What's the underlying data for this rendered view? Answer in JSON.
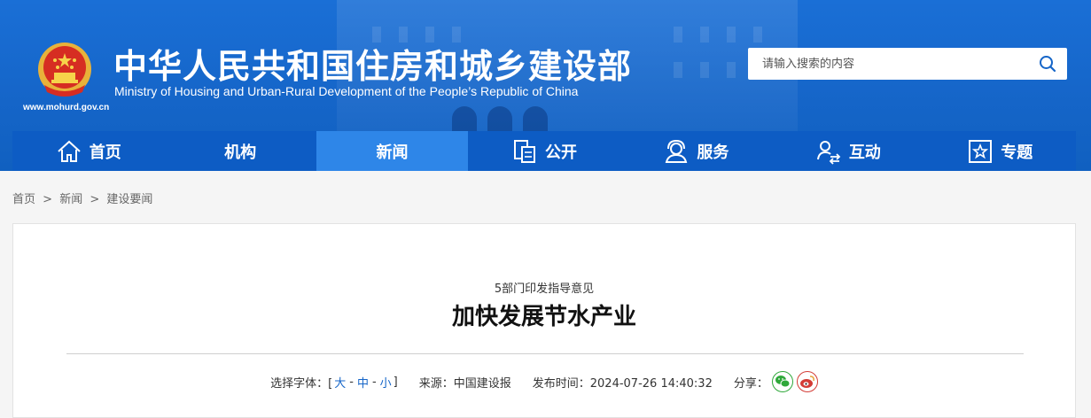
{
  "header": {
    "title": "中华人民共和国住房和城乡建设部",
    "subtitle": "Ministry of Housing and Urban-Rural Development of the People’s Republic of China",
    "url": "www.mohurd.gov.cn"
  },
  "search": {
    "placeholder": "请输入搜索的内容"
  },
  "nav": {
    "items": [
      {
        "label": "首页",
        "icon": "home-icon"
      },
      {
        "label": "机构"
      },
      {
        "label": "新闻"
      },
      {
        "label": "公开",
        "icon": "document-icon"
      },
      {
        "label": "服务",
        "icon": "service-icon"
      },
      {
        "label": "互动",
        "icon": "interact-icon"
      },
      {
        "label": "专题",
        "icon": "star-icon"
      }
    ],
    "active": "新闻"
  },
  "breadcrumb": {
    "items": [
      "首页",
      "新闻",
      "建设要闻"
    ],
    "sep": ">"
  },
  "article": {
    "kicker": "5部门印发指导意见",
    "title": "加快发展节水产业",
    "font_label": "选择字体：[",
    "font_large": "大",
    "font_medium": "中",
    "font_small": "小",
    "font_close": "]",
    "source": "来源：中国建设报",
    "time": "发布时间：2024-07-26 14:40:32",
    "share": "分享："
  },
  "colors": {
    "nav_bg": "#0d5cc4",
    "nav_active": "#2e86e8",
    "header_bg": "#1a6fd6",
    "wechat": "#2fa83a",
    "weibo": "#d33b35"
  }
}
